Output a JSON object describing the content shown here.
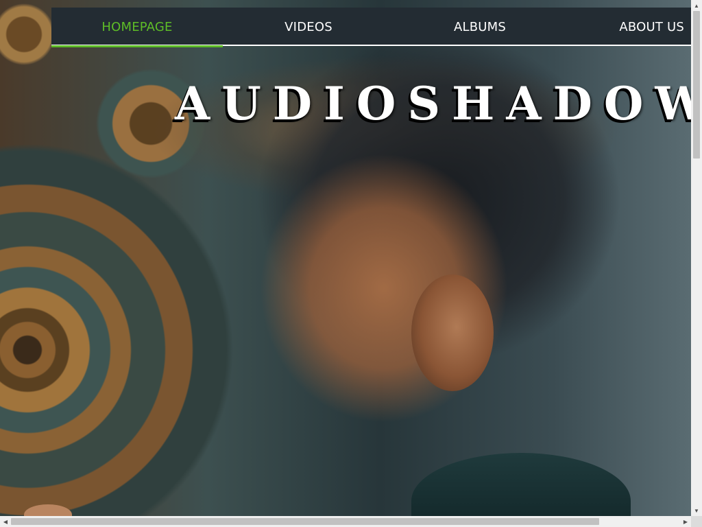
{
  "nav": {
    "items": [
      {
        "label": "HOMEPAGE",
        "active": true
      },
      {
        "label": "VIDEOS",
        "active": false
      },
      {
        "label": "ALBUMS",
        "active": false
      },
      {
        "label": "ABOUT US",
        "active": false
      }
    ]
  },
  "hero": {
    "title": "AUDIOSHADOW",
    "image_description_icon": "hero-image"
  },
  "colors": {
    "nav_background": "#232c33",
    "nav_active": "#5ebd27",
    "nav_text": "#ffffff",
    "title_text": "#ffffff"
  },
  "scrollbars": {
    "vertical_icons": [
      "triangle-up-icon",
      "triangle-down-icon"
    ],
    "horizontal_icons": [
      "triangle-left-icon",
      "triangle-right-icon"
    ]
  }
}
